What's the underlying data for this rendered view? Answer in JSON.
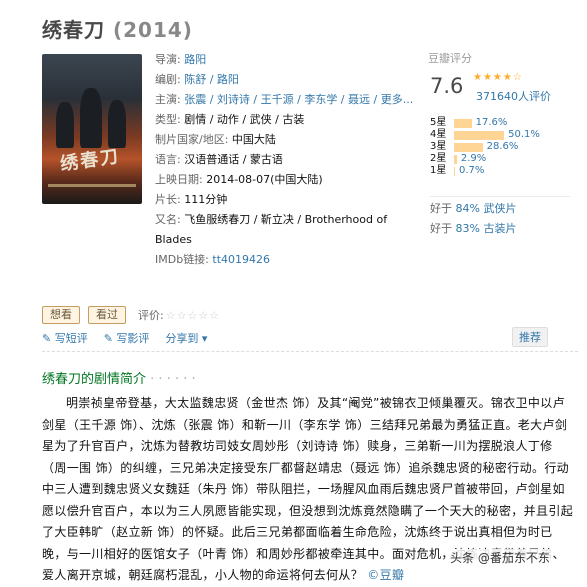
{
  "header": {
    "title": "绣春刀",
    "year": "(2014)"
  },
  "info": [
    {
      "label": "导演:",
      "value": "路阳",
      "link": true
    },
    {
      "label": "编剧:",
      "value": "陈舒 / 路阳",
      "link": true
    },
    {
      "label": "主演:",
      "value": "张震 / 刘诗诗 / 王千源 / 李东学 / 聂远 / 更多...",
      "link": true
    },
    {
      "label": "类型:",
      "value": "剧情 / 动作 / 武侠 / 古装",
      "link": false
    },
    {
      "label": "制片国家/地区:",
      "value": "中国大陆",
      "link": false
    },
    {
      "label": "语言:",
      "value": "汉语普通话 / 蒙古语",
      "link": false
    },
    {
      "label": "上映日期:",
      "value": "2014-08-07(中国大陆)",
      "link": false
    },
    {
      "label": "片长:",
      "value": "111分钟",
      "link": false
    },
    {
      "label": "又名:",
      "value": "飞鱼服绣春刀 / 靳立决 / Brotherhood of",
      "link": false
    },
    {
      "label": "",
      "value": "Blades",
      "link": false
    },
    {
      "label": "IMDb链接:",
      "value": "tt4019426",
      "link": true
    }
  ],
  "rating": {
    "header": "豆瓣评分",
    "score": "7.6",
    "stars": "★★★★☆",
    "votes": "371640人评价",
    "bars": [
      {
        "label": "5星",
        "pct_text": "17.6%",
        "pct": 17.6
      },
      {
        "label": "4星",
        "pct_text": "50.1%",
        "pct": 50.1
      },
      {
        "label": "3星",
        "pct_text": "28.6%",
        "pct": 28.6
      },
      {
        "label": "2星",
        "pct_text": "2.9%",
        "pct": 2.9
      },
      {
        "label": "1星",
        "pct_text": "0.7%",
        "pct": 0.7
      }
    ],
    "better": [
      {
        "prefix": "好于",
        "value": "84% 武侠片"
      },
      {
        "prefix": "好于",
        "value": "83% 古装片"
      }
    ]
  },
  "actions": {
    "want": "想看",
    "seen": "看过",
    "rate_label": "评价:",
    "empty_stars": "☆☆☆☆☆"
  },
  "ops": {
    "short_review": "写短评",
    "long_review": "写影评",
    "share": "分享到"
  },
  "recommend": "推荐",
  "poster": {
    "title": "绣春刀"
  },
  "synopsis": {
    "heading": "绣春刀的剧情简介",
    "dots": " · · · · · ·",
    "text": "明崇祯皇帝登基，大太监魏忠贤（金世杰 饰）及其“阉党”被锦衣卫倾巢覆灭。锦衣卫中以卢剑星（王千源 饰）、沈炼（张震 饰）和靳一川（李东学 饰）三结拜兄弟最为勇猛正直。老大卢剑星为了升官百户，沈炼为替教坊司妓女周妙彤（刘诗诗 饰）赎身，三弟靳一川为摆脱浪人丁修（周一围 饰）的纠缠，三兄弟决定接受东厂都督赵靖忠（聂远 饰）追杀魏忠贤的秘密行动。行动中三人遭到魏忠贤义女魏廷（朱丹 饰）带队阻拦，一场腥风血雨后魏忠贤尸首被带回，卢剑星如愿以偿升官百户，本以为三人夙愿皆能实现，但没想到沈炼竟然隐瞒了一个天大的秘密，并且引起了大臣韩旷（赵立新 饰）的怀疑。此后三兄弟都面临着生命危险，沈炼终于说出真相但为时已晚，与一川相好的医馆女子（叶青 饰）和周妙彤都被牵连其中。面对危机，沈炼决意带着兄弟、爱人离开京城，朝廷腐朽混乱，小人物的命运将何去何从？",
    "source": "©豆瓣"
  },
  "watermark": "头条 @番茄东不东"
}
